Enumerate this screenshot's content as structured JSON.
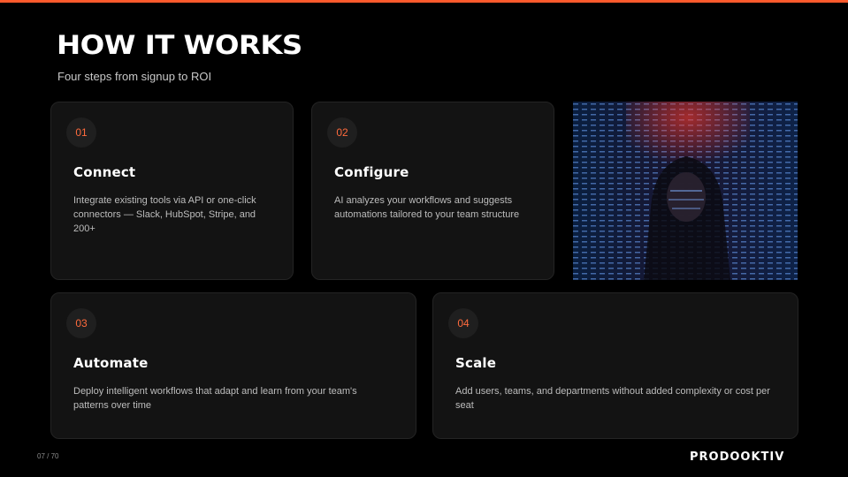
{
  "header": {
    "title": "HOW IT WORKS",
    "subtitle": "Four steps from signup to ROI"
  },
  "steps": [
    {
      "number": "01",
      "title": "Connect",
      "description": "Integrate existing tools via API or one-click connectors — Slack, HubSpot, Stripe, and 200+"
    },
    {
      "number": "02",
      "title": "Configure",
      "description": "AI analyzes your workflows and suggests automations tailored to your team structure"
    },
    {
      "number": "03",
      "title": "Automate",
      "description": "Deploy intelligent workflows that adapt and learn from your team's patterns over time"
    },
    {
      "number": "04",
      "title": "Scale",
      "description": "Add users, teams, and departments without added complexity or cost per seat"
    }
  ],
  "footer": {
    "page_indicator": "07 / 70",
    "logo_text": "PRODOOKTIV"
  },
  "colors": {
    "accent": "#ff5a2c",
    "background": "#000000",
    "card": "#131313"
  }
}
